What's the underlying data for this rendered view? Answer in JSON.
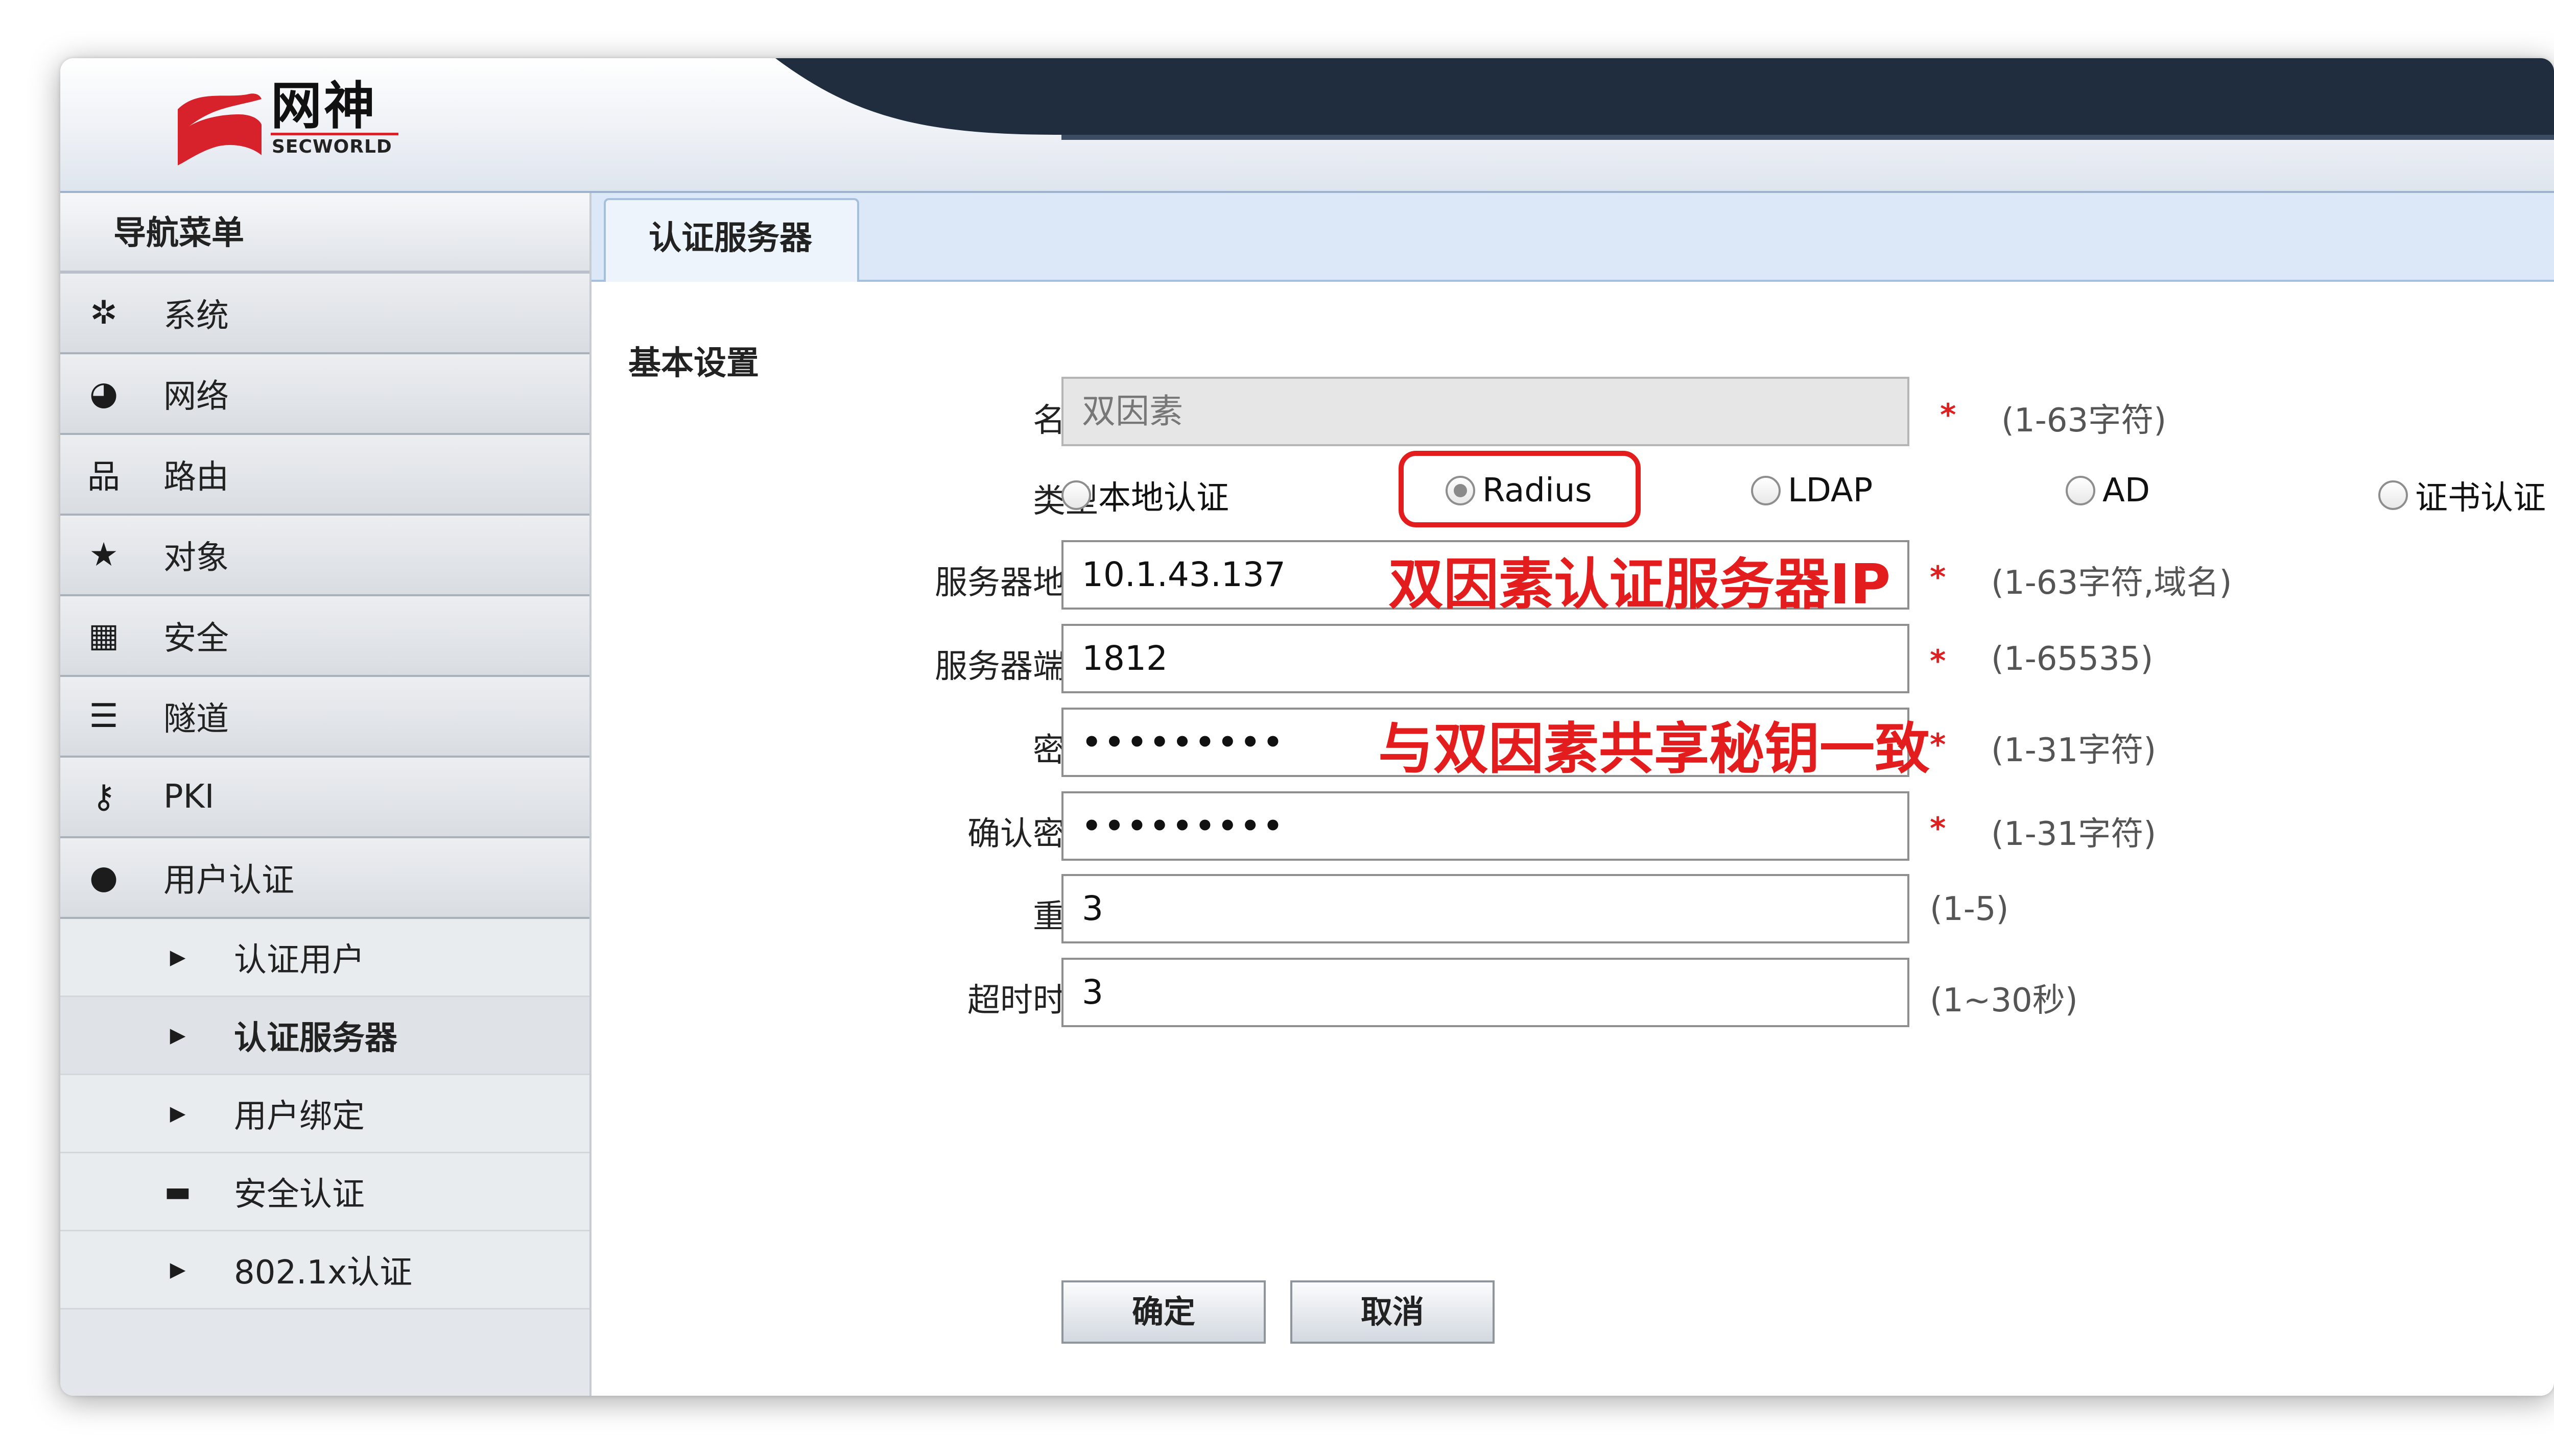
{
  "header": {
    "logo_text": "网神",
    "logo_sub": "SECWORLD",
    "brand_red": "#d7222b",
    "wave_color": "#1f2d3e"
  },
  "sidebar": {
    "title": "导航菜单",
    "items": [
      {
        "label": "系统",
        "icon": "gear-icon"
      },
      {
        "label": "网络",
        "icon": "globe-icon"
      },
      {
        "label": "路由",
        "icon": "network-tree-icon"
      },
      {
        "label": "对象",
        "icon": "star-icon"
      },
      {
        "label": "安全",
        "icon": "grid-icon"
      },
      {
        "label": "隧道",
        "icon": "tunnel-icon"
      },
      {
        "label": "PKI",
        "icon": "key-icon"
      },
      {
        "label": "用户认证",
        "icon": "user-icon"
      }
    ],
    "subitems": [
      {
        "label": "认证用户",
        "icon": "triangle-right-icon"
      },
      {
        "label": "认证服务器",
        "icon": "triangle-right-icon",
        "active": true
      },
      {
        "label": "用户绑定",
        "icon": "triangle-right-icon"
      },
      {
        "label": "安全认证",
        "icon": "folder-icon"
      },
      {
        "label": "802.1x认证",
        "icon": "triangle-right-icon"
      }
    ]
  },
  "main": {
    "tab": "认证服务器",
    "section_title": "基本设置",
    "form": {
      "name": {
        "label": "名称",
        "value": "双因素",
        "hint": "(1-63字符)",
        "required": "*"
      },
      "type": {
        "label": "类型",
        "options": [
          "本地认证",
          "Radius",
          "LDAP",
          "AD",
          "证书认证"
        ],
        "selected": "Radius"
      },
      "server_address": {
        "label": "服务器地址",
        "value": "10.1.43.137",
        "hint": "(1-63字符,域名)",
        "required": "*"
      },
      "server_port": {
        "label": "服务器端口",
        "value": "1812",
        "hint": "(1-65535)",
        "required": "*"
      },
      "secret": {
        "label": "密钥",
        "value": "•••••••••",
        "hint": "(1-31字符)",
        "required": "*"
      },
      "confirm_secret": {
        "label": "确认密钥",
        "value": "•••••••••",
        "hint": "(1-31字符)",
        "required": "*"
      },
      "retry": {
        "label": "重试",
        "value": "3",
        "hint": "(1-5)"
      },
      "timeout": {
        "label": "超时时间",
        "value": "3",
        "hint": "(1~30秒)"
      }
    },
    "buttons": {
      "ok": "确定",
      "cancel": "取消"
    }
  },
  "annotations": {
    "server_ip_note": "双因素认证服务器IP",
    "secret_note": "与双因素共享秘钥一致",
    "color": "#e31d1d"
  }
}
